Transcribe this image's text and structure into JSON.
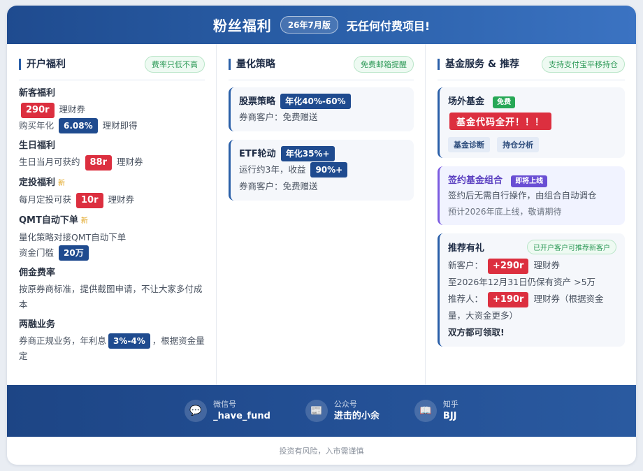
{
  "header": {
    "title": "粉丝福利",
    "version": "26年7月版",
    "slogan": "无任何付费项目!"
  },
  "col1": {
    "title": "开户福利",
    "pill": "费率只低不高",
    "new_customer": {
      "title": "新客福利",
      "badge": "290r",
      "text1": "理财券",
      "prefix2": "购买年化",
      "badge2": "6.08%",
      "suffix2": "理财即得"
    },
    "birthday": {
      "title": "生日福利",
      "prefix": "生日当月可获约",
      "badge": "88r",
      "suffix": "理财券"
    },
    "regular": {
      "title": "定投福利",
      "new_tag": "新",
      "prefix": "每月定投可获",
      "badge": "10r",
      "suffix": "理财券"
    },
    "qmt": {
      "title": "QMT自动下单",
      "new_tag": "新",
      "line1": "量化策略对接QMT自动下单",
      "prefix2": "资金门槛",
      "badge2": "20万"
    },
    "commission": {
      "title": "佣金费率",
      "text": "按原券商标准，提供截图申请，不让大家多付成本"
    },
    "margin": {
      "title": "两融业务",
      "prefix": "券商正规业务，年利息",
      "badge": "3%-4%",
      "suffix": "，根据资金量定"
    }
  },
  "col2": {
    "title": "量化策略",
    "pill": "免费邮箱提醒",
    "stock": {
      "title": "股票策略",
      "badge": "年化40%-60%",
      "line": "券商客户：免费赠送"
    },
    "etf": {
      "title": "ETF轮动",
      "badge": "年化35%+",
      "prefix": "运行约3年，收益",
      "badge2": "90%+",
      "line": "券商客户：免费赠送"
    }
  },
  "col3": {
    "title": "基金服务 & 推荐",
    "pill": "支持支付宝平移持仓",
    "otc": {
      "title": "场外基金",
      "tag": "免费",
      "big": "基金代码全开！！！",
      "chips": [
        "基金诊断",
        "持仓分析"
      ]
    },
    "signed": {
      "title": "签约基金组合",
      "tag": "即将上线",
      "line1": "签约后无需自行操作，由组合自动调仓",
      "line2": "预计2026年底上线，敬请期待"
    },
    "refer": {
      "title": "推荐有礼",
      "pill": "已开户客户可推荐新客户",
      "new_prefix": "新客户：",
      "new_badge": "+290r",
      "new_suffix": "理财券",
      "cond": "至2026年12月31日仍保有资产 >5万",
      "ref_prefix": "推荐人：",
      "ref_badge": "+190r",
      "ref_suffix": "理财券（根据资金量，大资金更多）",
      "both": "双方都可领取!"
    }
  },
  "footer": {
    "contacts": [
      {
        "label": "微信号",
        "value": "_have_fund",
        "icon": "chat-icon"
      },
      {
        "label": "公众号",
        "value": "进击的小余",
        "icon": "article-icon"
      },
      {
        "label": "知乎",
        "value": "BJJ",
        "icon": "book-icon"
      }
    ]
  },
  "disclaimer": "投资有风险，入市需谨慎"
}
